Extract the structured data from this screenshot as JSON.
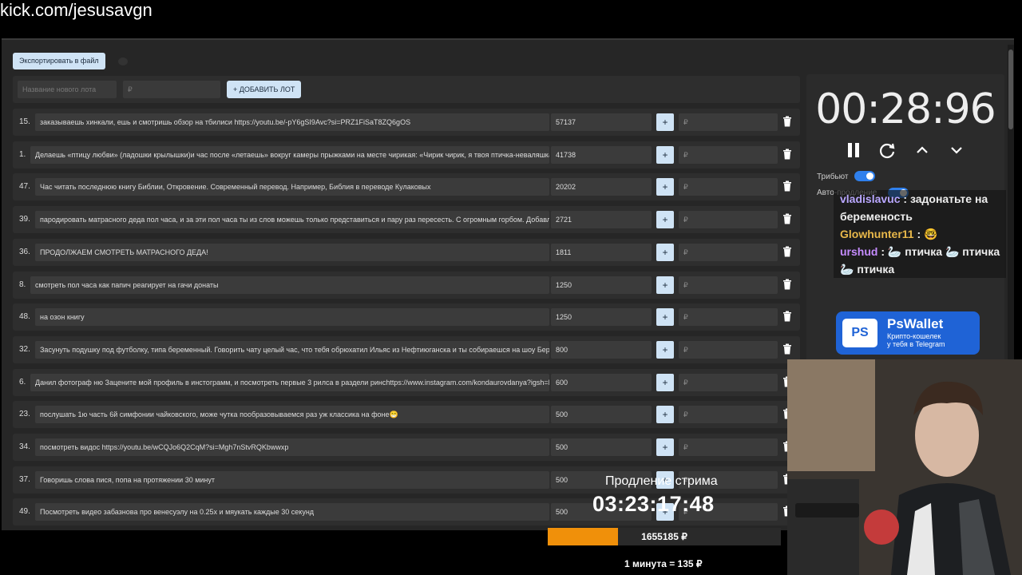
{
  "browser": {
    "url": "kick.com/jesusavgn"
  },
  "toolbar": {
    "export_label": "Экспортировать в файл"
  },
  "add_lot": {
    "name_placeholder": "Название нового лота",
    "amount_placeholder": "₽",
    "add_label": "+ ДОБАВИТЬ ЛОТ"
  },
  "lots": [
    {
      "num": "15.",
      "text": "заказываешь хинкали, ешь и смотришь обзор на тбилиси https://youtu.be/-pY6gSI9Avc?si=PRZ1FiSaT8ZQ6gOS",
      "amount": "57137"
    },
    {
      "num": "1.",
      "text": "Делаешь «птицу любви» (ладошки крылышки)и час после «летаешь» вокруг камеры прыжками на месте чирикая: «Чирик чирик, я твоя птичка-неваляшка",
      "amount": "41738"
    },
    {
      "num": "47.",
      "text": "Час читать последнюю книгу Библии, Откровение. Современный перевод. Например, Библия в переводе Кулаковых",
      "amount": "20202"
    },
    {
      "num": "39.",
      "text": "пародировать матрасного деда пол часа, и за эти пол часа ты из слов можешь только представиться и пару раз пересесть. С огромным горбом. Добавл",
      "amount": "2721"
    },
    {
      "num": "36.",
      "text": "ПРОДОЛЖАЕМ СМОТРЕТЬ МАТРАСНОГО ДЕДА!",
      "amount": "1811"
    },
    {
      "num": "8.",
      "text": "смотреть пол часа как папич реагирует на гачи донаты",
      "amount": "1250"
    },
    {
      "num": "48.",
      "text": "на озон книгу",
      "amount": "1250"
    },
    {
      "num": "32.",
      "text": "Засунуть подушку под футболку, типа беременный. Говорить чату целый час, что тебя обрюхатил Ильяс из Нефтиюганска и ты собираешся на шоу Бере",
      "amount": "800"
    },
    {
      "num": "6.",
      "text": "Данил фотограф ню Зацените мой профиль в инстограмм, и посмотреть первые 3 рилса в раздели pинchttps://www.instagram.com/kondaurovdanya?igsh=M",
      "amount": "600"
    },
    {
      "num": "23.",
      "text": "послушать 1ю часть 6й симфонии чайковского, може чутка пообразовываемся раз уж классика на фоне😁",
      "amount": "500"
    },
    {
      "num": "34.",
      "text": "посмотреть видос https://youtu.be/wCQJo6Q2CqM?si=Mgh7nStvRQKbwwxp",
      "amount": "500"
    },
    {
      "num": "37.",
      "text": "Говоришь слова пися, попа на протяжении 30 минут",
      "amount": "500"
    },
    {
      "num": "49.",
      "text": "Посмотреть видео забазнова про венесуэлу на 0.25х и мяукать каждые 30 секунд",
      "amount": "500"
    }
  ],
  "lot_rub_placeholder": "₽",
  "timer": {
    "value": "00:28:96"
  },
  "toggles": {
    "tribute_label": "Трибьют",
    "auto_label": "Авто-продление"
  },
  "chat": [
    {
      "user": "vladislavuc",
      "user_color": "#b9a7ff",
      "message": " : задонатьте на беременость"
    },
    {
      "user": "Glowhunter11",
      "user_color": "#e8b84a",
      "message": " : 🤓"
    },
    {
      "user": "urshud",
      "user_color": "#c58cff",
      "message": " : 🦢 птичка 🦢 птичка 🦢 птичка"
    }
  ],
  "ad": {
    "brand": "PsWallet",
    "logo": "PS",
    "tagline_1": "Крипто-кошелек",
    "tagline_2": "у тебя в Telegram"
  },
  "overlay": {
    "title": "Продление стрима",
    "clock": "03:23:17:48",
    "total": "1655185 ₽",
    "progress_fraction": 0.3,
    "rate": "1 минута = 135 ₽"
  },
  "colors": {
    "accent": "#cfe3f5",
    "toggle": "#2f80ed",
    "progress": "#f0900a",
    "bg": "#262626"
  }
}
